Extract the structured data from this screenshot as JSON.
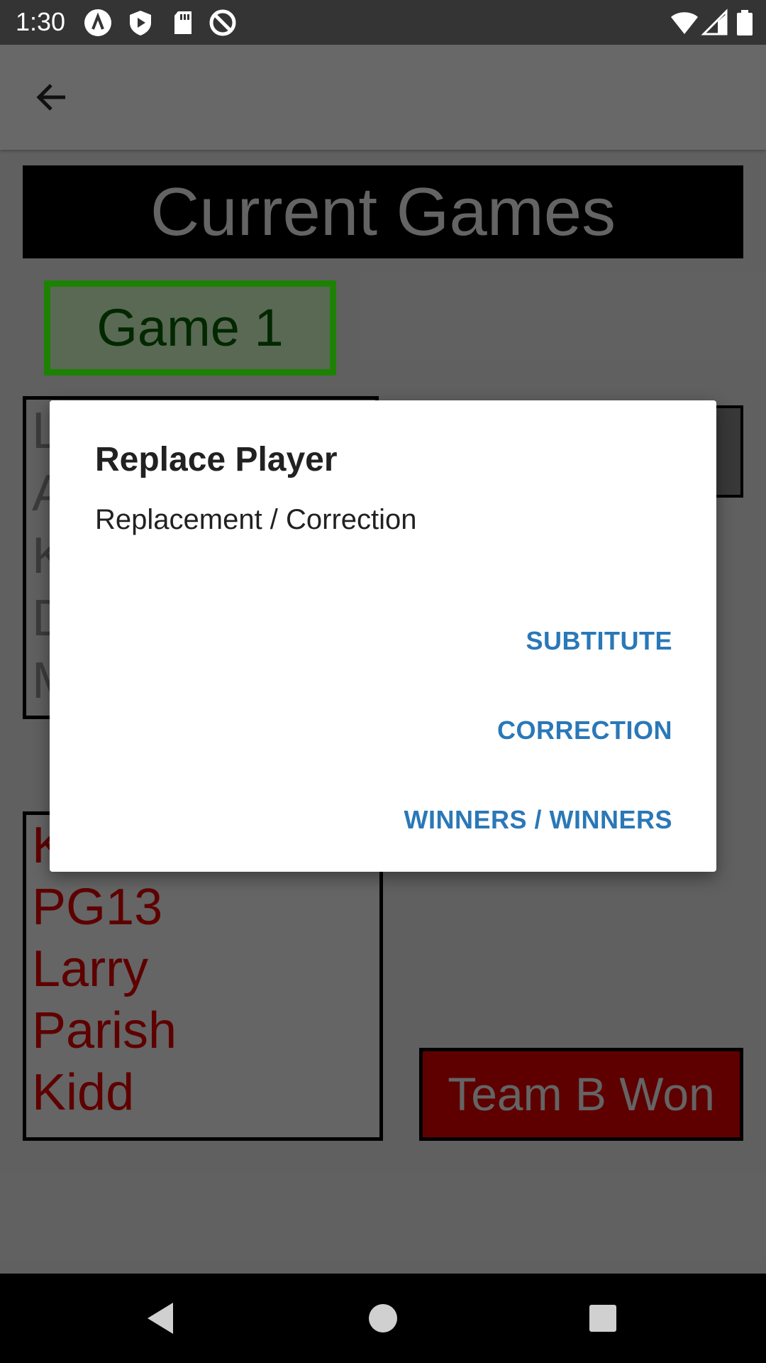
{
  "status_bar": {
    "time": "1:30"
  },
  "main": {
    "title": "Current Games",
    "game_label": "Game 1",
    "team_a_players": [
      "L",
      "A",
      "K",
      "D",
      "M"
    ],
    "team_b_players": [
      "K",
      "PG13",
      "Larry",
      "Parish",
      "Kidd"
    ],
    "won_label": "Team B Won"
  },
  "dialog": {
    "title": "Replace Player",
    "message": "Replacement / Correction",
    "actions": [
      "SUBTITUTE",
      "CORRECTION",
      "WINNERS / WINNERS"
    ]
  },
  "colors": {
    "accent": "#2a78b8",
    "game_border": "#1f8a05",
    "team_b_text": "#650000"
  }
}
